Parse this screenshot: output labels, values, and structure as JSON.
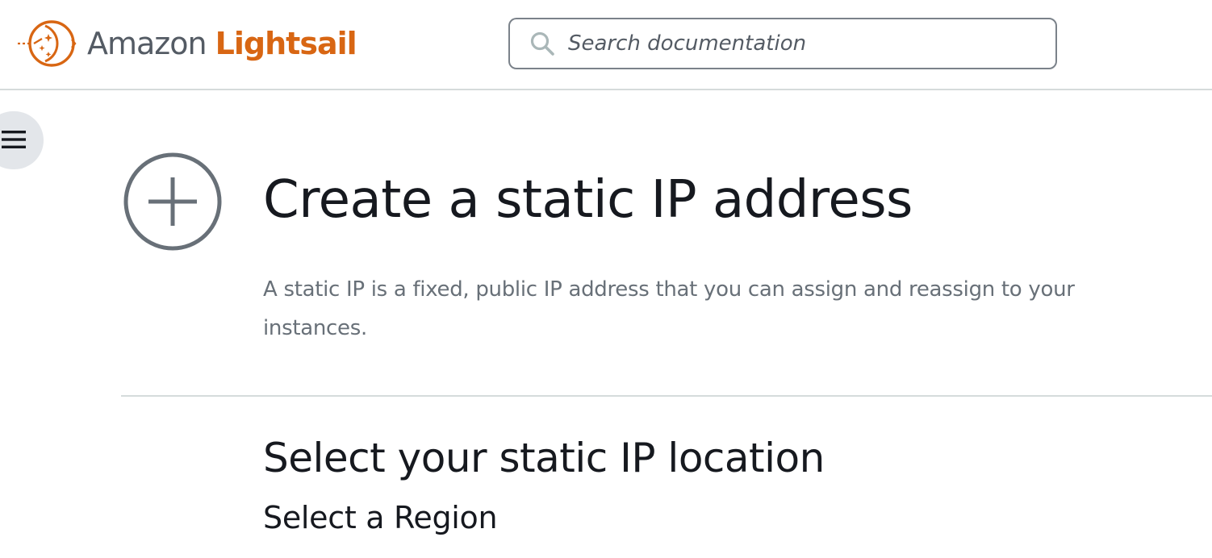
{
  "header": {
    "brand": {
      "prefix": "Amazon",
      "name": "Lightsail",
      "logo_icon": "lightsail-logo-icon",
      "prefix_color": "#545b64",
      "name_color": "#d86613"
    },
    "search": {
      "placeholder": "Search documentation",
      "value": "",
      "icon": "search-icon"
    }
  },
  "nav": {
    "toggle_icon": "hamburger-menu-icon"
  },
  "main": {
    "title_icon": "plus-circle-icon",
    "title": "Create a static IP address",
    "description": "A static IP is a fixed, public IP address that you can assign and reassign to your instances.",
    "section": {
      "title": "Select your static IP location",
      "subtitle": "Select a Region"
    }
  },
  "colors": {
    "accent": "#d86613",
    "text": "#16191f",
    "muted_text": "#687078",
    "divider": "#d5dbdb",
    "icon_gray": "#687078"
  }
}
